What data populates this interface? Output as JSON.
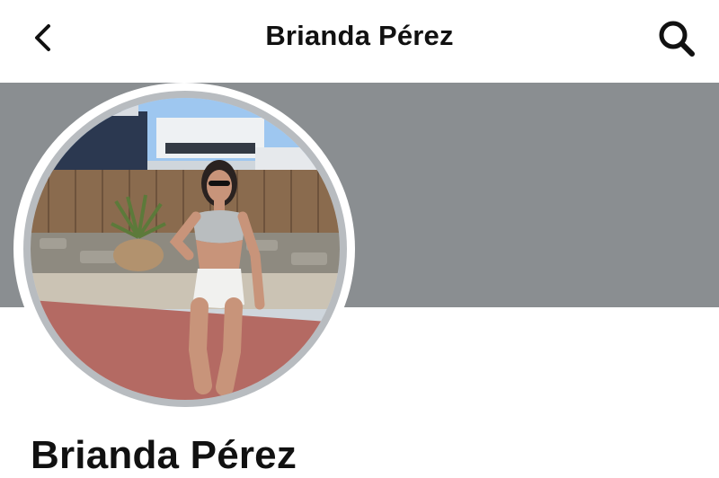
{
  "header": {
    "title": "Brianda Pérez",
    "back_icon": "chevron-left-icon",
    "search_icon": "search-icon"
  },
  "profile": {
    "name": "Brianda Pérez"
  },
  "colors": {
    "cover": "#8a8e91",
    "avatar_border": "#b8bcc0",
    "text": "#111111"
  }
}
